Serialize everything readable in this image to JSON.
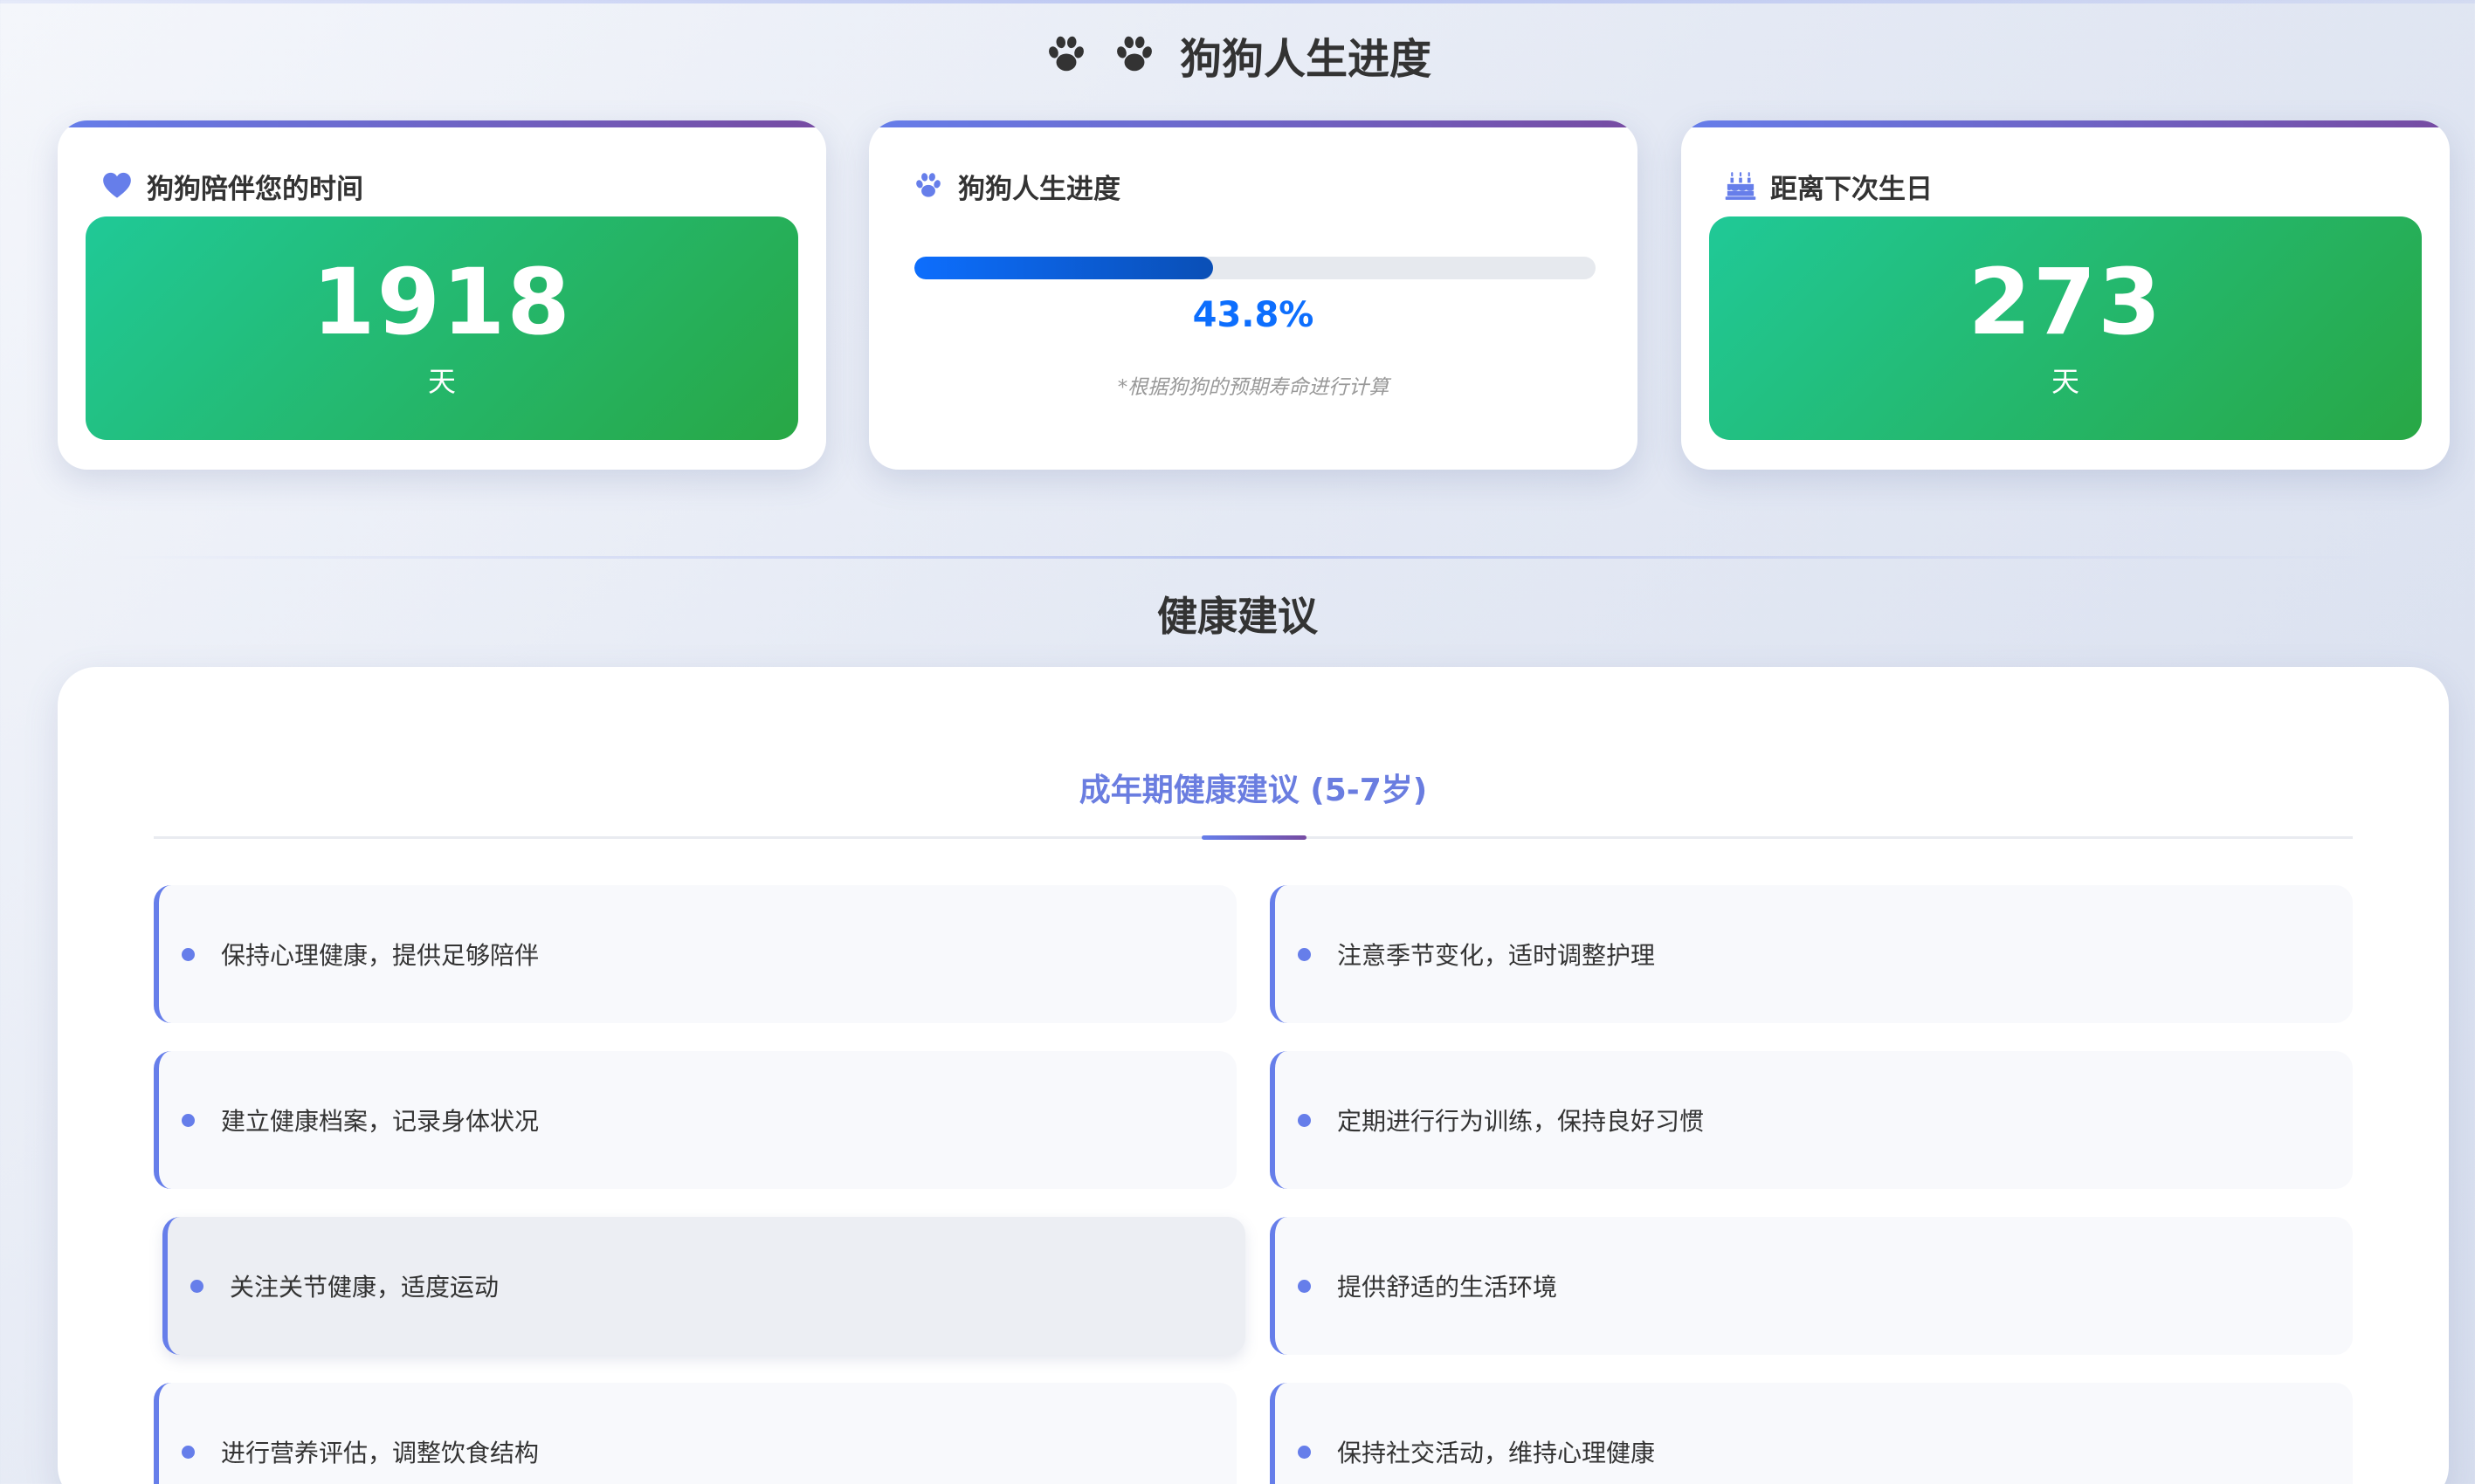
{
  "page": {
    "title": "狗狗人生进度"
  },
  "cards": {
    "companion": {
      "title": "狗狗陪伴您的时间",
      "value": "1918",
      "unit": "天"
    },
    "progress": {
      "title": "狗狗人生进度",
      "percent": 43.8,
      "percent_label": "43.8%",
      "note": "*根据狗狗的预期寿命进行计算"
    },
    "birthday": {
      "title": "距离下次生日",
      "value": "273",
      "unit": "天"
    }
  },
  "health": {
    "section_title": "健康建议",
    "stage_title": "成年期健康建议 (5-7岁)",
    "items": [
      "保持心理健康，提供足够陪伴",
      "注意季节变化，适时调整护理",
      "建立健康档案，记录身体状况",
      "定期进行行为训练，保持良好习惯",
      "关注关节健康，适度运动",
      "提供舒适的生活环境",
      "进行营养评估，调整饮食结构",
      "保持社交活动，维持心理健康"
    ]
  },
  "icons": {
    "title_icons": [
      "paw-icon",
      "paw-icon"
    ],
    "companion_icon": "heart-icon",
    "progress_icon": "paw-icon",
    "birthday_icon": "cake-icon"
  },
  "colors": {
    "accent": "#667eea",
    "accent_dark": "#764ba2",
    "green_start": "#20c997",
    "green_end": "#28a745",
    "progress_blue": "#0d6efd"
  }
}
